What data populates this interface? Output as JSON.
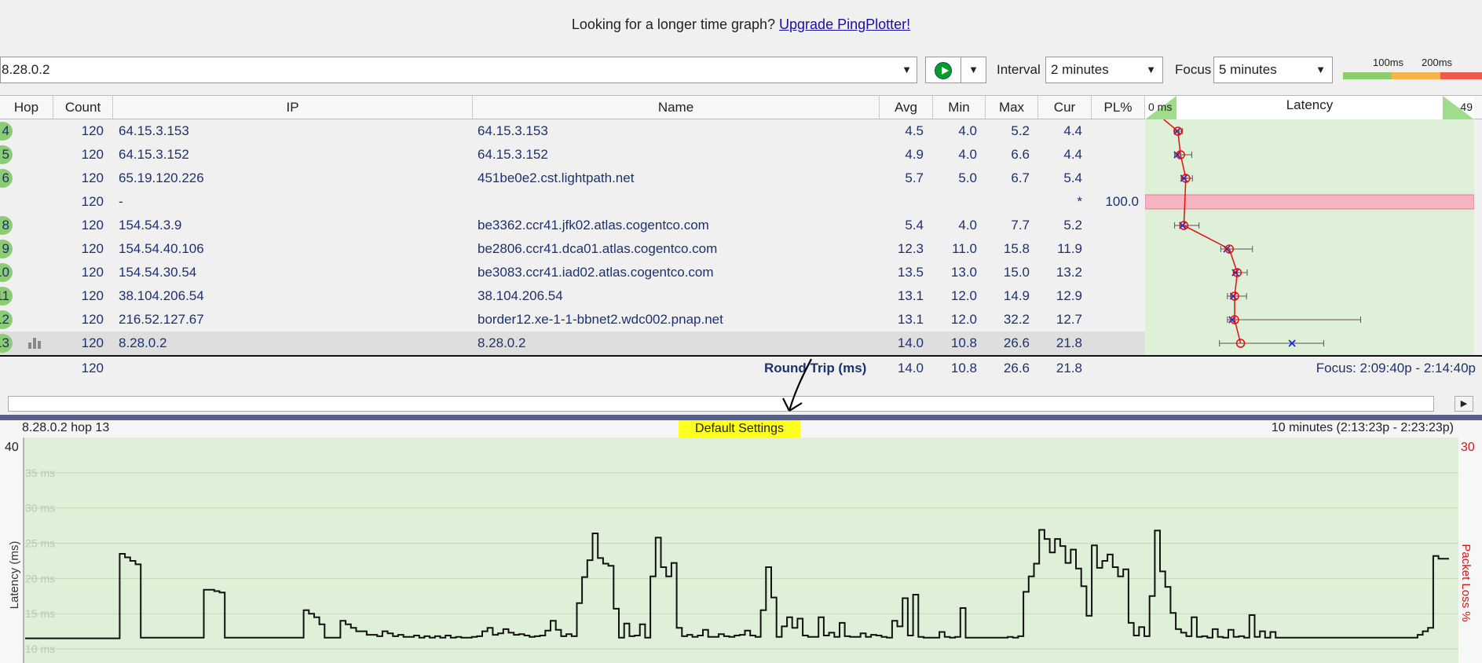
{
  "banner": {
    "text": "Looking for a longer time graph?",
    "link": "Upgrade PingPlotter!"
  },
  "toolbar": {
    "target": "8.28.0.2",
    "interval_label": "Interval",
    "interval_value": "2 minutes",
    "focus_label": "Focus",
    "focus_value": "5 minutes",
    "scale_100": "100ms",
    "scale_200": "200ms",
    "colors": {
      "good": "#8bcf6d",
      "warn": "#f6b54b",
      "bad": "#ef5b4a"
    }
  },
  "table": {
    "headers": {
      "hop": "Hop",
      "count": "Count",
      "ip": "IP",
      "name": "Name",
      "avg": "Avg",
      "min": "Min",
      "max": "Max",
      "cur": "Cur",
      "pl": "PL%"
    },
    "latency_header": {
      "title": "Latency",
      "left": "0 ms",
      "right": "49"
    },
    "rows": [
      {
        "hop": "4",
        "count": "120",
        "ip": "64.15.3.153",
        "name": "64.15.3.153",
        "avg": "4.5",
        "min": "4.0",
        "max": "5.2",
        "cur": "4.4",
        "pl": ""
      },
      {
        "hop": "5",
        "count": "120",
        "ip": "64.15.3.152",
        "name": "64.15.3.152",
        "avg": "4.9",
        "min": "4.0",
        "max": "6.6",
        "cur": "4.4",
        "pl": ""
      },
      {
        "hop": "6",
        "count": "120",
        "ip": "65.19.120.226",
        "name": "451be0e2.cst.lightpath.net",
        "avg": "5.7",
        "min": "5.0",
        "max": "6.7",
        "cur": "5.4",
        "pl": ""
      },
      {
        "hop": "",
        "count": "120",
        "ip": "-",
        "name": "",
        "avg": "",
        "min": "",
        "max": "",
        "cur": "*",
        "pl": "100.0"
      },
      {
        "hop": "8",
        "count": "120",
        "ip": "154.54.3.9",
        "name": "be3362.ccr41.jfk02.atlas.cogentco.com",
        "avg": "5.4",
        "min": "4.0",
        "max": "7.7",
        "cur": "5.2",
        "pl": ""
      },
      {
        "hop": "9",
        "count": "120",
        "ip": "154.54.40.106",
        "name": "be2806.ccr41.dca01.atlas.cogentco.com",
        "avg": "12.3",
        "min": "11.0",
        "max": "15.8",
        "cur": "11.9",
        "pl": ""
      },
      {
        "hop": "10",
        "count": "120",
        "ip": "154.54.30.54",
        "name": "be3083.ccr41.iad02.atlas.cogentco.com",
        "avg": "13.5",
        "min": "13.0",
        "max": "15.0",
        "cur": "13.2",
        "pl": ""
      },
      {
        "hop": "11",
        "count": "120",
        "ip": "38.104.206.54",
        "name": "38.104.206.54",
        "avg": "13.1",
        "min": "12.0",
        "max": "14.9",
        "cur": "12.9",
        "pl": ""
      },
      {
        "hop": "12",
        "count": "120",
        "ip": "216.52.127.67",
        "name": "border12.xe-1-1-bbnet2.wdc002.pnap.net",
        "avg": "13.1",
        "min": "12.0",
        "max": "32.2",
        "cur": "12.7",
        "pl": ""
      },
      {
        "hop": "13",
        "count": "120",
        "ip": "8.28.0.2",
        "name": "8.28.0.2",
        "avg": "14.0",
        "min": "10.8",
        "max": "26.6",
        "cur": "21.8",
        "pl": ""
      }
    ],
    "round_trip": {
      "count": "120",
      "label": "Round Trip (ms)",
      "avg": "14.0",
      "min": "10.8",
      "max": "26.6",
      "cur": "21.8",
      "focus": "Focus: 2:09:40p - 2:14:40p"
    }
  },
  "bottom": {
    "host": "8.28.0.2 hop 13",
    "annotation": "Default Settings",
    "range": "10 minutes (2:13:23p - 2:23:23p)"
  },
  "chart_data": {
    "type": "line",
    "title": "",
    "ylabel": "Latency (ms)",
    "y2label": "Packet Loss %",
    "ylim": [
      8,
      40
    ],
    "y_top_label": "40",
    "y2_top_label": "30",
    "y_ticks": [
      "35 ms",
      "30 ms",
      "25 ms",
      "20 ms",
      "15 ms",
      "10 ms"
    ],
    "grid": true,
    "values": [
      11.5,
      11.5,
      11.5,
      11.5,
      11.5,
      11.5,
      11.5,
      11.5,
      11.5,
      11.5,
      11.5,
      11.5,
      11.5,
      11.5,
      11.5,
      11.5,
      11.5,
      11.5,
      23.5,
      23,
      22.5,
      22,
      11.6,
      11.6,
      11.6,
      11.6,
      11.6,
      11.6,
      11.6,
      11.6,
      11.6,
      11.6,
      11.6,
      11.6,
      18.4,
      18.4,
      18.2,
      18,
      11.6,
      11.6,
      11.6,
      11.6,
      11.6,
      11.6,
      11.6,
      11.6,
      11.6,
      11.6,
      11.6,
      11.6,
      11.6,
      11.6,
      11.6,
      15.5,
      15,
      14.5,
      13.5,
      11.6,
      11.6,
      11.6,
      14,
      13.5,
      13,
      12.5,
      12.5,
      12,
      12,
      11.8,
      12.5,
      12.2,
      11.8,
      12,
      11.7,
      11.7,
      11.9,
      11.6,
      11.8,
      11.6,
      11.8,
      11.6,
      11.9,
      11.6,
      11.7,
      11.6,
      11.6,
      11.7,
      11.8,
      12.5,
      13,
      12,
      12.2,
      12.8,
      12.3,
      12,
      12.1,
      11.9,
      11.7,
      11.8,
      11.9,
      12.6,
      14,
      12.7,
      11.8,
      12.1,
      11.8,
      16.5,
      20.2,
      22.6,
      26.4,
      22.9,
      22.1,
      21.8,
      15.7,
      11.6,
      13.6,
      11.8,
      11.9,
      13.5,
      11.6,
      20.3,
      25.8,
      21.6,
      20.3,
      22.2,
      13,
      11.8,
      12,
      11.7,
      11.9,
      12.7,
      11.7,
      11.7,
      12.1,
      11.8,
      11.7,
      11.9,
      12,
      12.6,
      11.9,
      11.7,
      15.5,
      21.6,
      17.3,
      11.7,
      13.2,
      14.5,
      13,
      14.3,
      11.9,
      11.7,
      11.7,
      14.5,
      11.9,
      12.3,
      11.7,
      13.7,
      11.8,
      11.7,
      11.7,
      12.2,
      11.7,
      12,
      11.9,
      11.7,
      11.6,
      14,
      13.2,
      17.2,
      11.9,
      17.7,
      11.7,
      11.6,
      11.6,
      11.6,
      12.4,
      11.7,
      11.6,
      11.7,
      15.8,
      11.6,
      11.6,
      11.6,
      11.6,
      11.6,
      11.6,
      11.6,
      11.6,
      11.7,
      11.6,
      11.8,
      18.1,
      20.3,
      22.1,
      26.9,
      25.6,
      23.7,
      25.6,
      24.6,
      22.2,
      24.1,
      21.4,
      18.9,
      14.7,
      24.7,
      21.5,
      22.5,
      23.4,
      21.6,
      20.3,
      21.3,
      13.7,
      11.9,
      13.1,
      11.8,
      17.5,
      26.8,
      21,
      18.8,
      15.1,
      12.8,
      12.3,
      11.8,
      14.5,
      11.7,
      11.8,
      11.6,
      12.8,
      11.7,
      11.6,
      12.7,
      11.7,
      11.8,
      11.6,
      14.8,
      11.7,
      12.5,
      11.6,
      12.4,
      11.6,
      11.6,
      11.6,
      11.6,
      11.6,
      11.6,
      11.6,
      11.6,
      11.6,
      11.6,
      11.6,
      11.6,
      11.6,
      11.6,
      11.6,
      11.6,
      11.6,
      11.6,
      11.6,
      11.6,
      11.6,
      11.6,
      11.6,
      11.6,
      11.6,
      11.6,
      11.6,
      12,
      12.5,
      13,
      23.2,
      22.8,
      22.8
    ]
  }
}
